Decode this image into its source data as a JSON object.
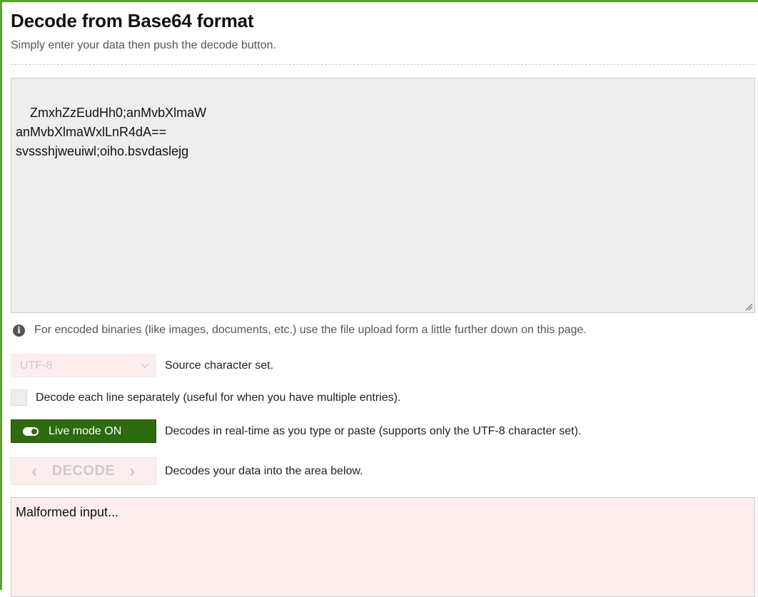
{
  "header": {
    "title": "Decode from Base64 format",
    "subtitle": "Simply enter your data then push the decode button."
  },
  "input": {
    "value": "ZmxhZzEudHh0;anMvbXlmaW\nanMvbXlmaWxlLnR4dA==\nsvssshjweuiwl;oiho.bsvdaslejg"
  },
  "info": {
    "text": "For encoded binaries (like images, documents, etc.) use the file upload form a little further down on this page.",
    "icon": "info-icon"
  },
  "charset": {
    "selected": "UTF-8",
    "label": "Source character set."
  },
  "line_option": {
    "checked": false,
    "label": "Decode each line separately (useful for when you have multiple entries)."
  },
  "live_mode": {
    "button_label": "Live mode ON",
    "description": "Decodes in real-time as you type or paste (supports only the UTF-8 character set)."
  },
  "decode": {
    "button_label": "DECODE",
    "description": "Decodes your data into the area below."
  },
  "output": {
    "value": "Malformed input..."
  },
  "colors": {
    "accent_green": "#5aa62a",
    "live_button": "#2d6a10",
    "error_background": "#fdeeee"
  }
}
